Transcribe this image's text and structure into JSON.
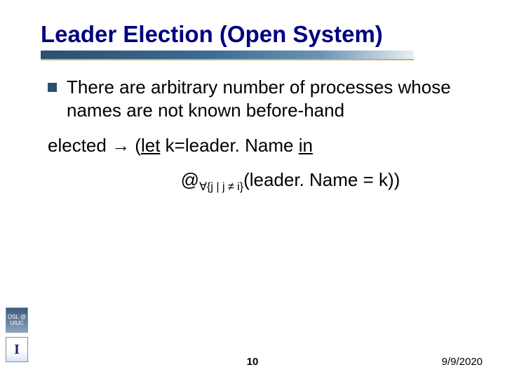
{
  "title": "Leader Election (Open System)",
  "bullet": "There are arbitrary number of processes whose names are not known before-hand",
  "formula1": {
    "prefix": "elected → (",
    "let": "let",
    "mid": " k=leader. Name ",
    "in": "in"
  },
  "formula2": {
    "at": "@",
    "sub": "∀{j | j ≠ i}",
    "rest": "(leader. Name = k))"
  },
  "logo_osl": "OSL @ UIUC",
  "logo_ill": "I",
  "slide_number": "10",
  "slide_date": "9/9/2020"
}
